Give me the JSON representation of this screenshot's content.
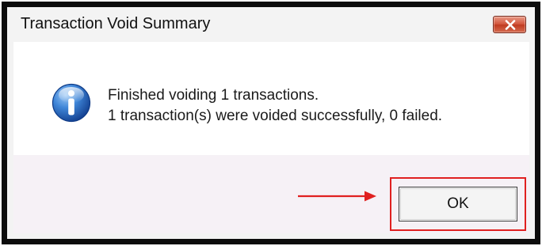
{
  "dialog": {
    "title": "Transaction Void Summary",
    "close_icon": "close-icon",
    "message_icon": "info-icon",
    "message_lines": [
      "Finished voiding 1 transactions.",
      "1 transaction(s) were voided successfully, 0 failed."
    ],
    "ok_label": "OK"
  },
  "annotation": {
    "color": "#e02020",
    "arrow_icon": "arrow-right-icon"
  },
  "colors": {
    "frame": "#0c0c0c",
    "content_background": "#ffffff",
    "footer_background": "#f6f1f6",
    "info_icon_blue": "#1f5fb8",
    "close_button_red": "#c8452a"
  }
}
